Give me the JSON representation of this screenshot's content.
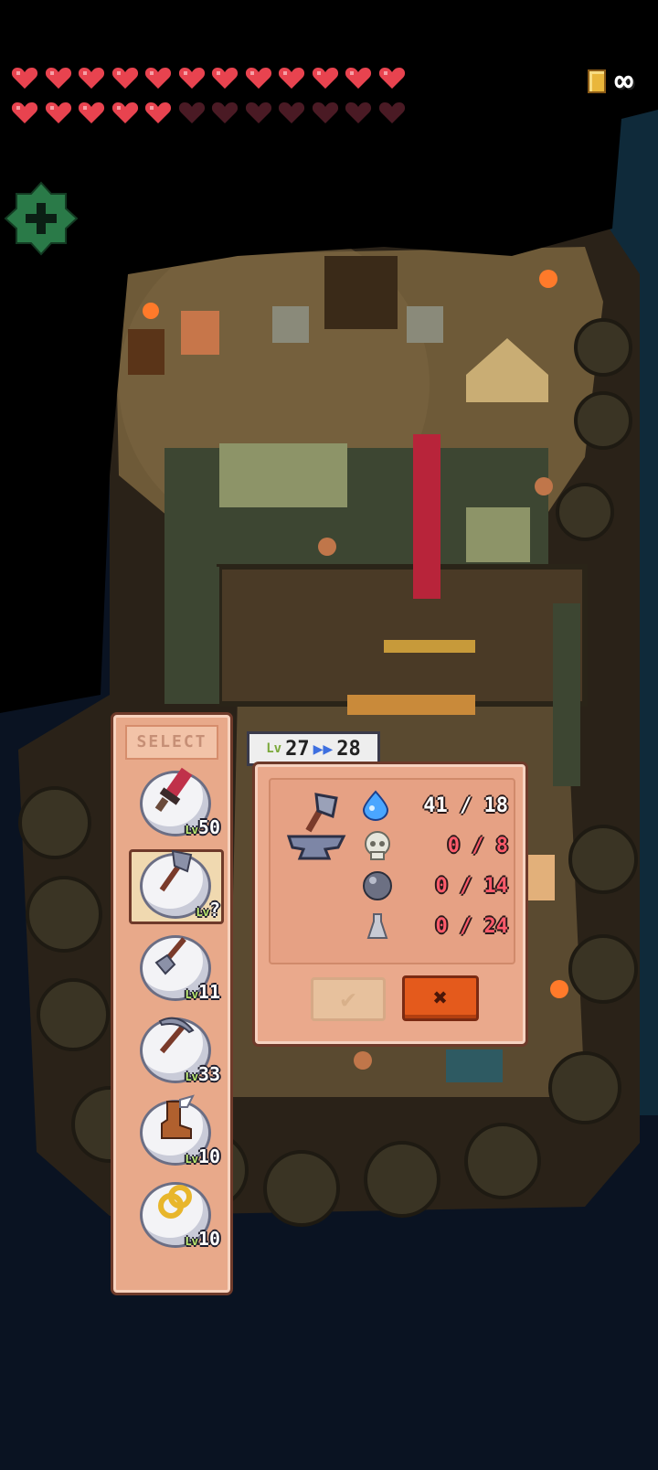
{
  "hud": {
    "hearts_full": 17,
    "hearts_total": 24,
    "currency_icon": "gold-card-icon",
    "currency_value": "∞"
  },
  "add_button_icon": "plus-icon",
  "select_panel": {
    "title": "SELECT",
    "items": [
      {
        "icon": "sword-icon",
        "level_tag": "Lv",
        "level": "50"
      },
      {
        "icon": "axe-icon",
        "level_tag": "Lv",
        "level": "?",
        "selected": true
      },
      {
        "icon": "shovel-icon",
        "level_tag": "Lv",
        "level": "11"
      },
      {
        "icon": "pickaxe-icon",
        "level_tag": "Lv",
        "level": "33"
      },
      {
        "icon": "boot-icon",
        "level_tag": "Lv",
        "level": "10"
      },
      {
        "icon": "ring-icon",
        "level_tag": "Lv",
        "level": "10"
      }
    ]
  },
  "upgrade": {
    "level_tag": "Lv",
    "current_level": "27",
    "next_level": "28",
    "tool_icon": "axe-on-anvil-icon",
    "requirements": [
      {
        "icon": "blue-gem-icon",
        "have_need": "41 / 18",
        "color": "#ffffff"
      },
      {
        "icon": "skull-icon",
        "have_need": "0 / 8",
        "color": "#ff5b6b"
      },
      {
        "icon": "iron-ball-icon",
        "have_need": "0 / 14",
        "color": "#ff5b6b"
      },
      {
        "icon": "silver-ore-icon",
        "have_need": "0 / 24",
        "color": "#ff5b6b"
      }
    ],
    "confirm_label": "✔",
    "cancel_label": "✖"
  }
}
